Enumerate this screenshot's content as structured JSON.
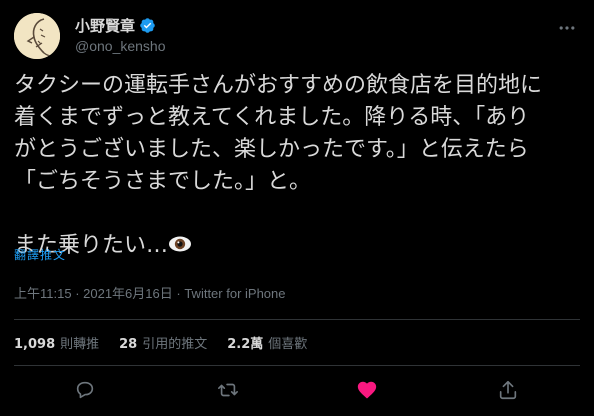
{
  "colors": {
    "background": "#000000",
    "text": "#d9d9d9",
    "muted": "#6e767d",
    "link": "#1d9bf0",
    "verified": "#1d9bf0",
    "like": "#f91880",
    "divider": "#2f3336"
  },
  "user": {
    "display_name": "小野賢章",
    "handle": "@ono_kensho",
    "verified": true,
    "verified_icon": "verified-badge-icon",
    "avatar_icon": "avatar"
  },
  "tweet": {
    "text": "タクシーの運転手さんがおすすめの飲食店を目的地に\n着くまでずっと教えてくれました。降りる時、「あり\nがとうございました、楽しかったです。」と伝えたら\n「ごちそうさまでした。」と。\n\nまた乗りたい…",
    "emoji_icon": "eye-icon",
    "translate_label": "翻譯推文"
  },
  "meta": {
    "time": "上午11:15",
    "separator": " · ",
    "date": "2021年6月16日",
    "source": "Twitter for iPhone"
  },
  "stats": [
    {
      "count": "1,098",
      "label": "則轉推"
    },
    {
      "count": "28",
      "label": "引用的推文"
    },
    {
      "count": "2.2萬",
      "label": "個喜歡"
    }
  ],
  "actions": {
    "reply_icon": "reply-icon",
    "retweet_icon": "retweet-icon",
    "like_icon": "heart-icon",
    "like_active": true,
    "share_icon": "share-icon"
  },
  "header": {
    "more_icon": "more-icon"
  }
}
